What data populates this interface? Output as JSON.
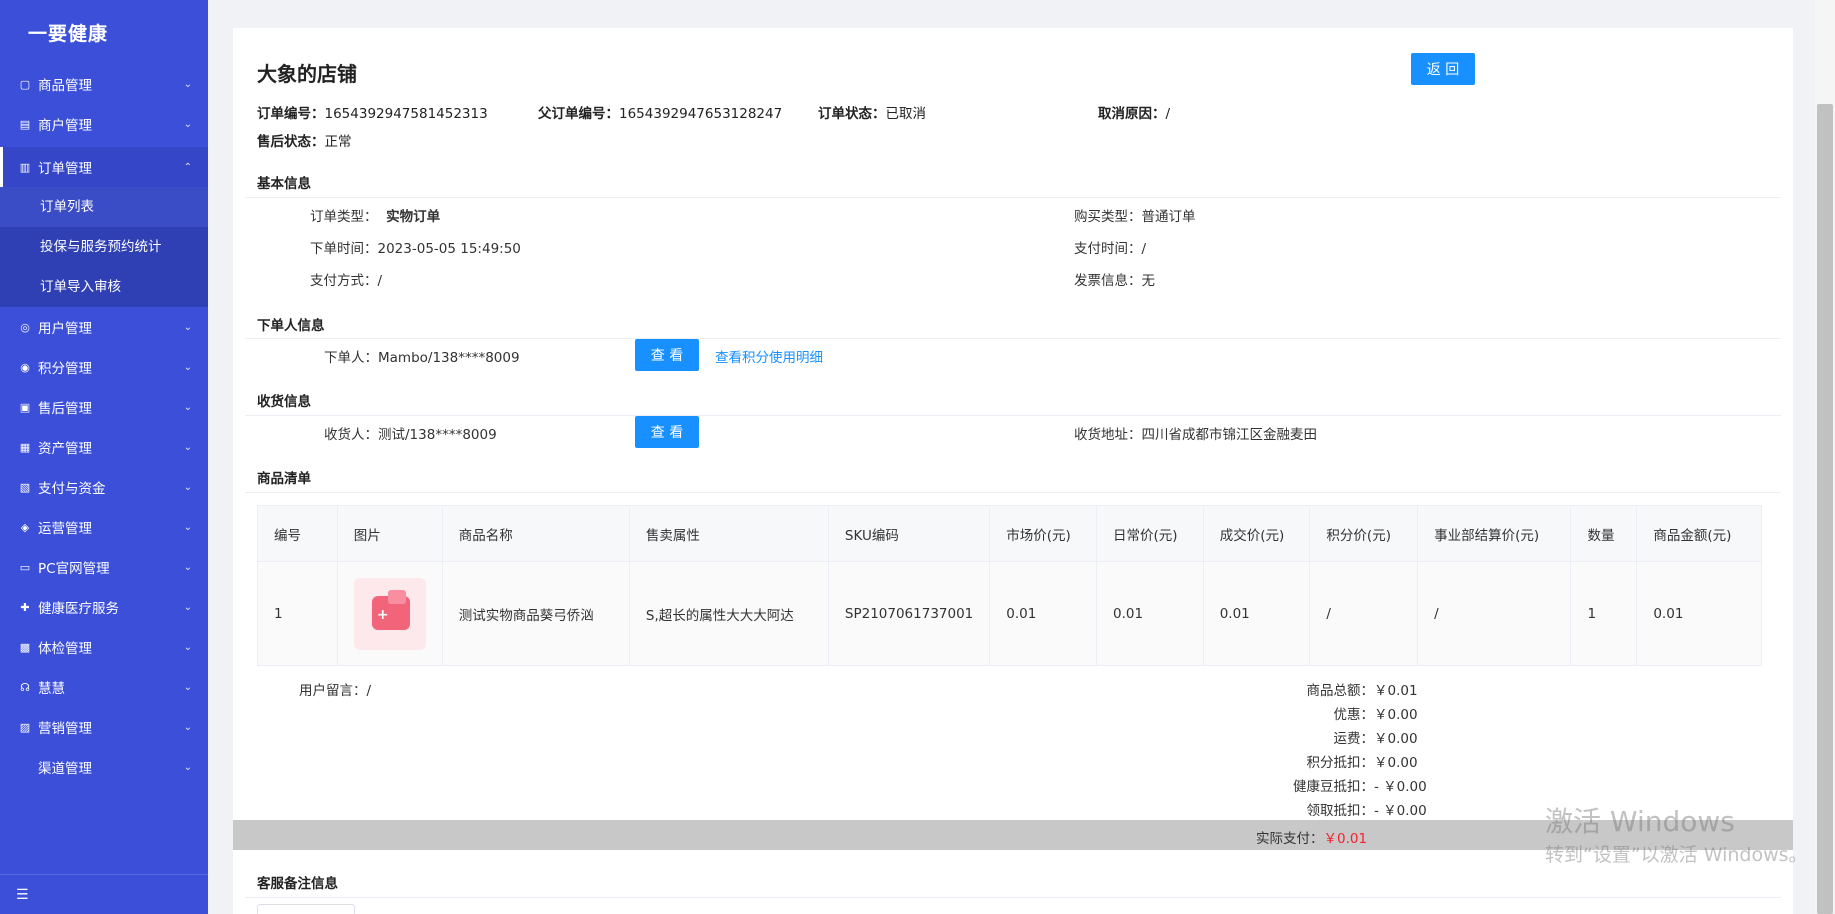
{
  "sidebar": {
    "brand": "一要健康",
    "items": [
      {
        "label": "商品管理",
        "icon": "box-icon"
      },
      {
        "label": "商户管理",
        "icon": "store-icon"
      }
    ],
    "open_item": {
      "label": "订单管理",
      "icon": "order-icon"
    },
    "submenu": [
      "订单列表",
      "投保与服务预约统计",
      "订单导入审核"
    ],
    "items_after": [
      {
        "label": "用户管理",
        "icon": "user-icon"
      },
      {
        "label": "积分管理",
        "icon": "points-icon"
      },
      {
        "label": "售后管理",
        "icon": "aftersale-icon"
      },
      {
        "label": "资产管理",
        "icon": "asset-icon"
      },
      {
        "label": "支付与资金",
        "icon": "payment-icon"
      },
      {
        "label": "运营管理",
        "icon": "operation-icon"
      },
      {
        "label": "PC官网管理",
        "icon": "pc-icon"
      },
      {
        "label": "健康医疗服务",
        "icon": "medical-icon"
      },
      {
        "label": "体检管理",
        "icon": "checkup-icon"
      },
      {
        "label": "慧慧",
        "icon": "headset-icon"
      },
      {
        "label": "营销管理",
        "icon": "marketing-icon"
      },
      {
        "label": "渠道管理",
        "icon": ""
      }
    ]
  },
  "header": {
    "shop_name": "大象的店铺",
    "back_label": "返 回",
    "order_no_label": "订单编号：",
    "order_no": "1654392947581452313",
    "parent_no_label": "父订单编号：",
    "parent_no": "1654392947653128247",
    "status_label": "订单状态：",
    "status": "已取消",
    "cancel_label": "取消原因：",
    "cancel": "/",
    "aftersale_label": "售后状态：",
    "aftersale": "正常"
  },
  "basic": {
    "title": "基本信息",
    "order_type_label": "订单类型：",
    "order_type": "实物订单",
    "buy_type_label": "购买类型：",
    "buy_type": "普通订单",
    "order_time_label": "下单时间：",
    "order_time": "2023-05-05 15:49:50",
    "pay_time_label": "支付时间：",
    "pay_time": "/",
    "pay_method_label": "支付方式：",
    "pay_method": "/",
    "invoice_label": "发票信息：",
    "invoice": "无"
  },
  "buyer": {
    "title": "下单人信息",
    "label": "下单人：",
    "value": "Mambo/138****8009",
    "view_label": "查 看",
    "points_link": "查看积分使用明细"
  },
  "receiver": {
    "title": "收货信息",
    "label": "收货人：",
    "value": "测试/138****8009",
    "view_label": "查 看",
    "address_label": "收货地址：",
    "address": "四川省成都市锦江区金融麦田"
  },
  "goods": {
    "title": "商品清单",
    "columns": [
      "编号",
      "图片",
      "商品名称",
      "售卖属性",
      "SKU编码",
      "市场价(元)",
      "日常价(元)",
      "成交价(元)",
      "积分价(元)",
      "事业部结算价(元)",
      "数量",
      "商品金额(元)"
    ],
    "rows": [
      {
        "no": "1",
        "name": "测试实物商品葵弓侨汹",
        "attr": "S,超长的属性大大大阿达",
        "sku": "SP2107061737001",
        "market": "0.01",
        "daily": "0.01",
        "deal": "0.01",
        "points": "/",
        "division": "/",
        "qty": "1",
        "amount": "0.01"
      }
    ]
  },
  "summary": {
    "remark_label": "用户留言：",
    "remark": "/",
    "rows": [
      {
        "label": "商品总额：",
        "value": "￥0.01"
      },
      {
        "label": "优惠：",
        "value": "￥0.00"
      },
      {
        "label": "运费：",
        "value": "￥0.00"
      },
      {
        "label": "积分抵扣：",
        "value": "￥0.00"
      },
      {
        "label": "健康豆抵扣：",
        "value": "- ￥0.00"
      },
      {
        "label": "领取抵扣：",
        "value": "- ￥0.00"
      }
    ],
    "paid_label": "实际支付：",
    "paid": "￥0.01",
    "paid_color": "#f5222d"
  },
  "service_remark": {
    "title": "客服备注信息"
  },
  "watermark": {
    "line1": "激活 Windows",
    "line2": "转到“设置”以激活 Windows。"
  },
  "colors": {
    "sidebar": "#3b4fd8",
    "primary": "#1890ff"
  }
}
